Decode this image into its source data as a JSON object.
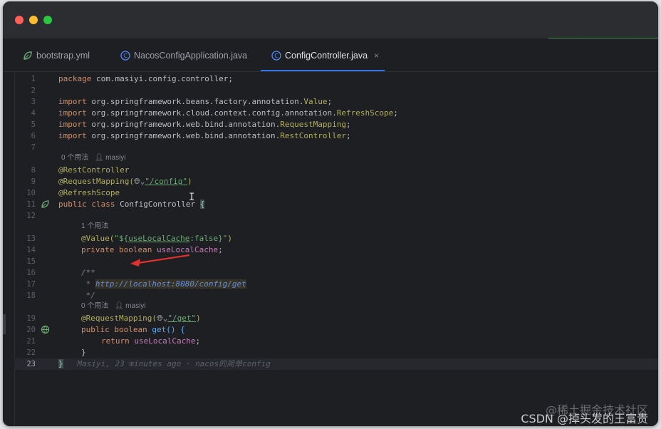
{
  "tabs": [
    {
      "label": "bootstrap.yml",
      "icon": "yaml-leaf-icon",
      "active": false
    },
    {
      "label": "NacosConfigApplication.java",
      "icon": "java-class-icon",
      "active": false
    },
    {
      "label": "ConfigController.java",
      "icon": "java-class-icon",
      "active": true,
      "close": "×"
    }
  ],
  "line_numbers": [
    "1",
    "2",
    "3",
    "4",
    "5",
    "6",
    "7",
    "8",
    "9",
    "10",
    "11",
    "12",
    "13",
    "14",
    "15",
    "16",
    "17",
    "18",
    "19",
    "20",
    "21",
    "22",
    "23"
  ],
  "hints": {
    "usage_0_a": "0 个用法",
    "author_a": "masiyi",
    "usage_1": "1 个用法",
    "usage_0_b": "0 个用法",
    "author_b": "masiyi"
  },
  "code": {
    "l1_kw": "package",
    "l1_rest": " com.masiyi.config.controller;",
    "l3_kw": "import",
    "l3_pre": " org.springframework.beans.factory.annotation.",
    "l3_cls": "Value",
    "l4_kw": "import",
    "l4_pre": " org.springframework.cloud.context.config.annotation.",
    "l4_cls": "RefreshScope",
    "l5_kw": "import",
    "l5_pre": " org.springframework.web.bind.annotation.",
    "l5_cls": "RequestMapping",
    "l6_kw": "import",
    "l6_pre": " org.springframework.web.bind.annotation.",
    "l6_cls": "RestController",
    "l8": "@RestController",
    "l9_ann": "@RequestMapping(",
    "l9_str": "\"/config\"",
    "l9_end": ")",
    "l10": "@RefreshScope",
    "l11_kw": "public class",
    "l11_cls": " ConfigController ",
    "l11_brace": "{",
    "l13_ann": "@Value(",
    "l13_q1": "\"${",
    "l13_prop": "useLocalCache",
    "l13_def": ":false}\"",
    "l13_end": ")",
    "l14_kw": "private boolean",
    "l14_fld": " useLocalCache",
    "l14_end": ";",
    "l16": "/**",
    "l17_star": " * ",
    "l17_link": "http://localhost:8080/config/get",
    "l18": " */",
    "l19_ann": "@RequestMapping(",
    "l19_str": "\"/get\"",
    "l19_end": ")",
    "l20_kw": "public boolean",
    "l20_rest": " get() {",
    "l21_kw": "return",
    "l21_fld": " useLocalCache",
    "l21_end": ";",
    "l22": "}",
    "l23_brace": "}",
    "l23_blame": "Masiyi, 23 minutes ago · nacos的简单config"
  },
  "watermark": {
    "line1": "@稀土掘金技术社区",
    "line2": "CSDN @掉头发的王富贵"
  },
  "colors": {
    "keyword": "#cf8e6d",
    "annotation": "#b3ae60",
    "string": "#6aab73",
    "field": "#c77dbb",
    "accent": "#3574f0"
  }
}
